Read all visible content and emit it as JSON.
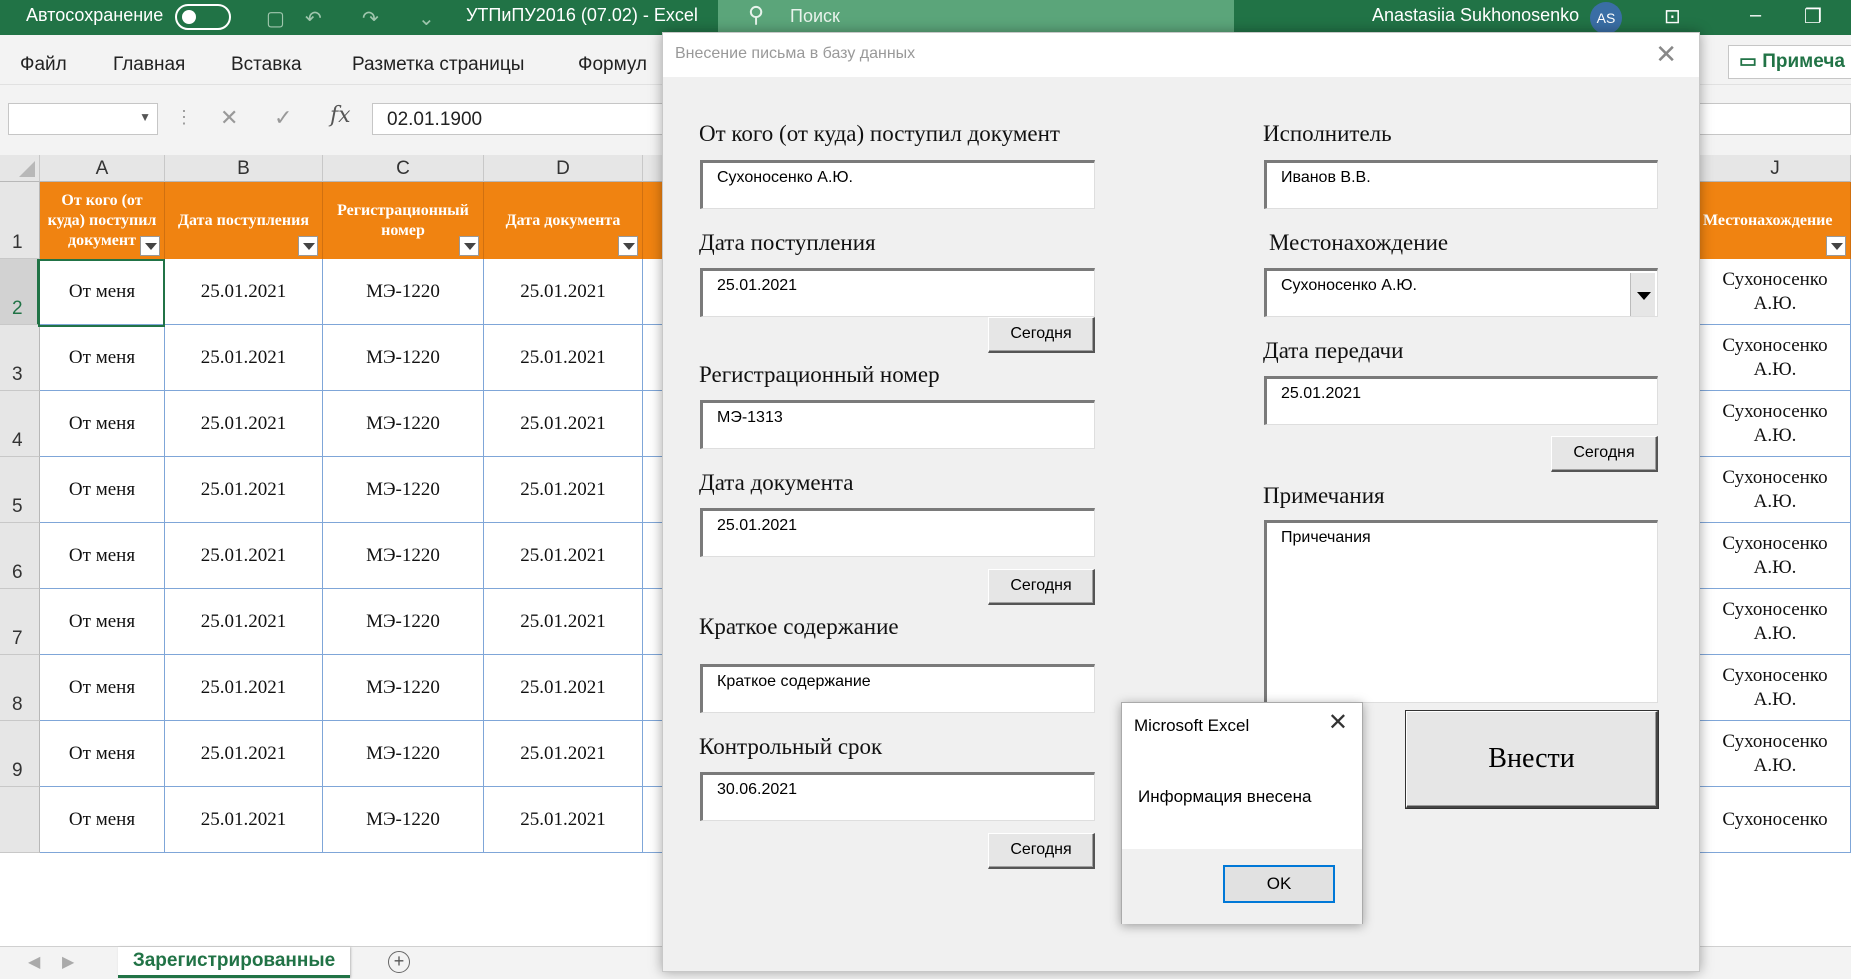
{
  "titlebar": {
    "autosave": "Автосохранение",
    "doc_title": "УТПиПУ2016 (07.02)  -  Excel",
    "search": "Поиск",
    "user": "Anastasiia Sukhonosenko",
    "avatar": "AS",
    "icons": [
      "save-icon",
      "undo-icon",
      "redo-icon",
      "customize-icon",
      "search-icon",
      "ribbon-display-icon",
      "restore-icon"
    ],
    "accent": "#217346"
  },
  "ribbon": {
    "tabs": [
      "Файл",
      "Главная",
      "Вставка",
      "Разметка страницы",
      "Формул"
    ],
    "notes_button": "Примеча"
  },
  "formula_bar": {
    "name_box": "",
    "cancel_icon": "✕",
    "enter_icon": "✓",
    "fx": "fx",
    "value": "02.01.1900"
  },
  "sheet": {
    "columns": [
      "A",
      "B",
      "C",
      "D",
      "J"
    ],
    "headers": [
      "От кого (от куда) поступил документ",
      "Дата поступления",
      "Регистрационный номер",
      "Дата документа",
      "Местонахождение"
    ],
    "header_color": "#f08311",
    "rows": [
      {
        "num": "2",
        "a": "От меня",
        "b": "25.01.2021",
        "c": "МЭ-1220",
        "d": "25.01.2021",
        "j": "Сухоносенко А.Ю."
      },
      {
        "num": "3",
        "a": "От меня",
        "b": "25.01.2021",
        "c": "МЭ-1220",
        "d": "25.01.2021",
        "j": "Сухоносенко А.Ю."
      },
      {
        "num": "4",
        "a": "От меня",
        "b": "25.01.2021",
        "c": "МЭ-1220",
        "d": "25.01.2021",
        "j": "Сухоносенко А.Ю."
      },
      {
        "num": "5",
        "a": "От меня",
        "b": "25.01.2021",
        "c": "МЭ-1220",
        "d": "25.01.2021",
        "j": "Сухоносенко А.Ю."
      },
      {
        "num": "6",
        "a": "От меня",
        "b": "25.01.2021",
        "c": "МЭ-1220",
        "d": "25.01.2021",
        "j": "Сухоносенко А.Ю."
      },
      {
        "num": "7",
        "a": "От меня",
        "b": "25.01.2021",
        "c": "МЭ-1220",
        "d": "25.01.2021",
        "j": "Сухоносенко А.Ю."
      },
      {
        "num": "8",
        "a": "От меня",
        "b": "25.01.2021",
        "c": "МЭ-1220",
        "d": "25.01.2021",
        "j": "Сухоносенко А.Ю."
      },
      {
        "num": "9",
        "a": "От меня",
        "b": "25.01.2021",
        "c": "МЭ-1220",
        "d": "25.01.2021",
        "j": "Сухоносенко А.Ю."
      },
      {
        "num": "",
        "a": "От меня",
        "b": "25.01.2021",
        "c": "МЭ-1220",
        "d": "25.01.2021",
        "j": "Сухоносенко"
      }
    ],
    "header_row_num": "1",
    "sheet_tab": "Зарегистрированные",
    "add_sheet": "+"
  },
  "form": {
    "title": "Внесение письма в базу данных",
    "close": "✕",
    "from_label": "От кого (от куда) поступил документ",
    "from_value": "Сухоносенко А.Ю.",
    "received_label": "Дата поступления",
    "received_value": "25.01.2021",
    "regnum_label": "Регистрационный номер",
    "regnum_value": "МЭ-1313",
    "docdate_label": "Дата документа",
    "docdate_value": "25.01.2021",
    "summary_label": "Краткое содержание",
    "summary_value": "Краткое содержание",
    "deadline_label": "Контрольный срок",
    "deadline_value": "30.06.2021",
    "executor_label": "Исполнитель",
    "executor_value": "Иванов В.В.",
    "location_label": "Местонахождение",
    "location_value": "Сухоносенко А.Ю.",
    "transfer_label": "Дата передачи",
    "transfer_value": "25.01.2021",
    "notes_label": "Примечания",
    "notes_value": "Причечания",
    "today": "Сегодня",
    "submit": "Внести"
  },
  "message": {
    "title": "Microsoft Excel",
    "close": "✕",
    "text": "Информация внесена",
    "ok": "OK"
  }
}
